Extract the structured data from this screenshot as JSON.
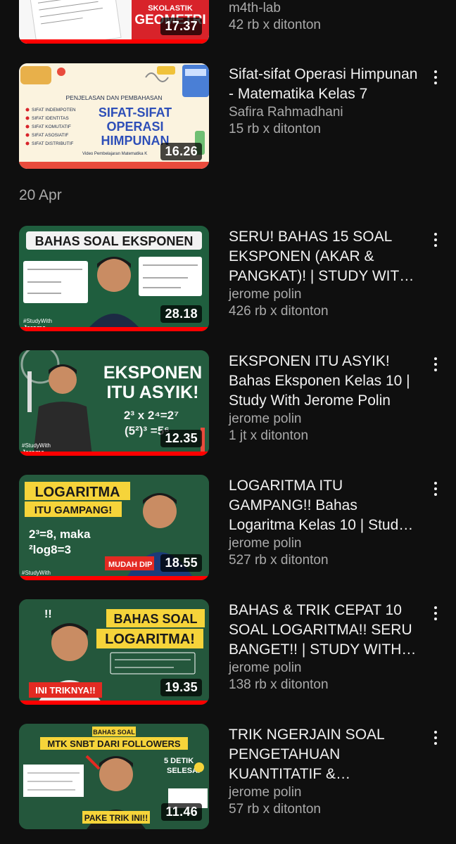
{
  "section_label": "20 Apr",
  "videos": [
    {
      "title": "",
      "channel": "m4th-lab",
      "views": "42 rb x ditonton",
      "duration": "17.37",
      "progress": 1.0,
      "thumb_text": [
        "SKOLASTIK",
        "GEOMETRI"
      ]
    },
    {
      "title": "Sifat-sifat Operasi Himpunan - Matematika Kelas 7",
      "channel": "Safira Rahmadhani",
      "views": "15 rb x ditonton",
      "duration": "16.26",
      "progress": 0.0,
      "thumb_text": [
        "PENJELASAN DAN PEMBAHASAN",
        "SIFAT-SIFAT",
        "OPERASI",
        "HIMPUNAN",
        "SIFAT INDEMPOTEN",
        "SIFAT IDENTITAS",
        "SIFAT KOMUTATIF",
        "SIFAT ASOSIATIF",
        "SIFAT DISTRIBUTIF",
        "Video Pembelajaran Matematika K"
      ]
    },
    {
      "title": "SERU! BAHAS 15 SOAL EKSPONEN (AKAR & PANGKAT)! | STUDY WITH JEROME POLIN",
      "channel": "jerome polin",
      "views": "426 rb x ditonton",
      "duration": "28.18",
      "progress": 1.0,
      "thumb_text": [
        "BAHAS SOAL EKSPONEN",
        "#StudyWith",
        "Jerome"
      ]
    },
    {
      "title": "EKSPONEN ITU ASYIK! Bahas Eksponen Kelas 10 | Study With Jerome Polin",
      "channel": "jerome polin",
      "views": "1 jt x ditonton",
      "duration": "12.35",
      "progress": 1.0,
      "thumb_text": [
        "EKSPONEN",
        "ITU ASYIK!",
        "2³ x 2⁴=2⁷",
        "(5²)³ =5⁶",
        "#StudyWith",
        "Jerome"
      ]
    },
    {
      "title": "LOGARITMA ITU GAMPANG!! Bahas Logaritma Kelas 10 | Study With Jerome Polin",
      "channel": "jerome polin",
      "views": "527 rb x ditonton",
      "duration": "18.55",
      "progress": 1.0,
      "thumb_text": [
        "LOGARITMA",
        "ITU GAMPANG!",
        "2³=8, maka",
        "²log8=3",
        "MUDAH DIP",
        "#StudyWith"
      ]
    },
    {
      "title": "BAHAS & TRIK CEPAT 10 SOAL LOGARITMA!! SERU BANGET!! | STUDY WITH JEROME POLIN",
      "channel": "jerome polin",
      "views": "138 rb x ditonton",
      "duration": "19.35",
      "progress": 1.0,
      "thumb_text": [
        "BAHAS SOAL",
        "LOGARITMA!",
        "INI TRIKNYA!!",
        "!!"
      ]
    },
    {
      "title": "TRIK NGERJAIN SOAL PENGETAHUAN KUANTITATIF & MATEMATIKA",
      "channel": "jerome polin",
      "views": "57 rb x ditonton",
      "duration": "11.46",
      "progress": 0.0,
      "thumb_text": [
        "BAHAS SOAL",
        "MTK SNBT DARI FOLLOWERS",
        "5 DETIK",
        "SELESAI",
        "PAKE TRIK INI!!"
      ]
    }
  ],
  "colors": {
    "background": "#0f0f0f",
    "progress": "#ff0000",
    "meta": "#aaaaaa"
  },
  "icons": {
    "menu": "more-vert-icon"
  }
}
